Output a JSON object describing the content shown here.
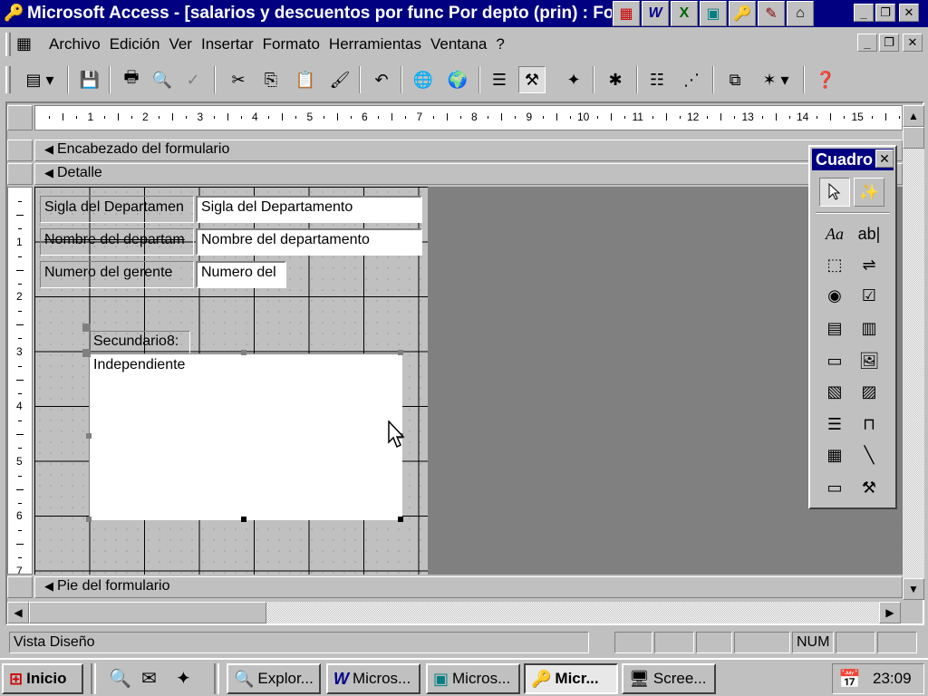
{
  "window": {
    "title": "Microsoft Access - [salarios y descuentos por func Por depto (prin) : Fo",
    "controls": {
      "minimize": "_",
      "maximize": "❐",
      "close": "✕"
    }
  },
  "office_bar": {
    "apps": [
      {
        "name": "office-icon",
        "glyph": "▦"
      },
      {
        "name": "word-icon",
        "glyph": "W"
      },
      {
        "name": "excel-icon",
        "glyph": "X"
      },
      {
        "name": "powerpoint-icon",
        "glyph": "▣"
      },
      {
        "name": "access-icon",
        "glyph": "🔑"
      },
      {
        "name": "schedule-icon",
        "glyph": "✎"
      },
      {
        "name": "binder-icon",
        "glyph": "⌂"
      }
    ]
  },
  "menubar": {
    "items": [
      "Archivo",
      "Edición",
      "Ver",
      "Insertar",
      "Formato",
      "Herramientas",
      "Ventana",
      "?"
    ],
    "controls": {
      "minimize": "_",
      "restore": "❐",
      "close": "✕"
    }
  },
  "ruler": {
    "numbers": [
      "1",
      "2",
      "3",
      "4",
      "5",
      "6",
      "7",
      "8",
      "9",
      "10",
      "11",
      "12",
      "13",
      "14",
      "15"
    ],
    "vertical_numbers": [
      "1",
      "2",
      "3",
      "4",
      "5",
      "6",
      "7"
    ]
  },
  "form": {
    "header_section": "Encabezado del formulario",
    "detail_section": "Detalle",
    "footer_section": "Pie del formulario",
    "section_arrow": "◀",
    "fields": [
      {
        "label": "Sigla del Departamen",
        "value": "Sigla del Departamento"
      },
      {
        "label": "Nombre del departam",
        "value": "Nombre del departamento"
      },
      {
        "label": "Numero del gerente",
        "value": "Numero del"
      }
    ],
    "subform": {
      "label": "Secundario8:",
      "content": "Independiente"
    }
  },
  "toolbox": {
    "title": "Cuadro",
    "close": "✕"
  },
  "status": {
    "text": "Vista Diseño",
    "num": "NUM"
  },
  "taskbar": {
    "start": "Inicio",
    "buttons": [
      "Explor...",
      "Micros...",
      "Micros...",
      "Micr...",
      "Scree..."
    ],
    "clock": "23:09"
  }
}
